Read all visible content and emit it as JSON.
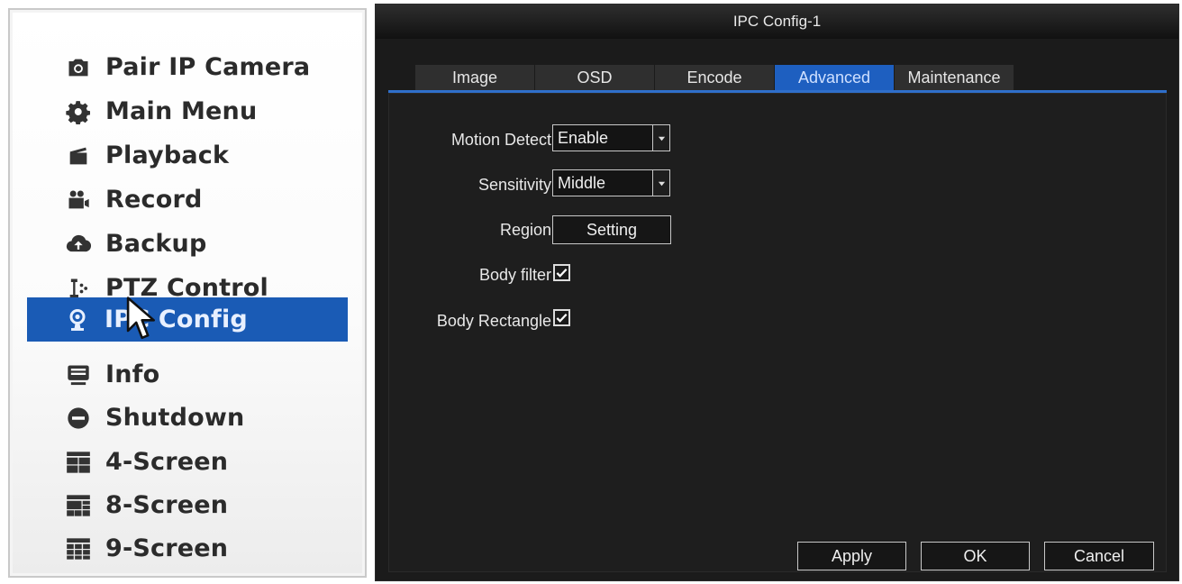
{
  "menu": {
    "items": [
      {
        "label": "Pair IP Camera",
        "icon": "camera-icon"
      },
      {
        "label": "Main Menu",
        "icon": "gear-icon"
      },
      {
        "label": "Playback",
        "icon": "playback-icon"
      },
      {
        "label": "Record",
        "icon": "record-icon"
      },
      {
        "label": "Backup",
        "icon": "cloud-upload-icon"
      },
      {
        "label": "PTZ Control",
        "icon": "ptz-icon"
      },
      {
        "label": "IPC Config",
        "icon": "ipc-camera-icon",
        "selected": true
      },
      {
        "label": "Info",
        "icon": "info-monitor-icon"
      },
      {
        "label": "Shutdown",
        "icon": "shutdown-icon"
      },
      {
        "label": "4-Screen",
        "icon": "grid-4-icon"
      },
      {
        "label": "8-Screen",
        "icon": "grid-8-icon"
      },
      {
        "label": "9-Screen",
        "icon": "grid-9-icon"
      }
    ]
  },
  "dialog": {
    "title": "IPC Config-1",
    "tabs": [
      "Image",
      "OSD",
      "Encode",
      "Advanced",
      "Maintenance"
    ],
    "active_tab": "Advanced",
    "fields": {
      "motion_detect": {
        "label": "Motion Detect",
        "value": "Enable"
      },
      "sensitivity": {
        "label": "Sensitivity",
        "value": "Middle"
      },
      "region": {
        "label": "Region",
        "button": "Setting"
      },
      "body_filter": {
        "label": "Body filter",
        "checked": true
      },
      "body_rectangle": {
        "label": "Body Rectangle",
        "checked": true
      }
    },
    "buttons": {
      "apply": "Apply",
      "ok": "OK",
      "cancel": "Cancel"
    }
  },
  "colors": {
    "menu_selected": "#1a5bb5",
    "tab_active": "#1e5fc0",
    "dialog_bg": "#1b1b1b"
  }
}
